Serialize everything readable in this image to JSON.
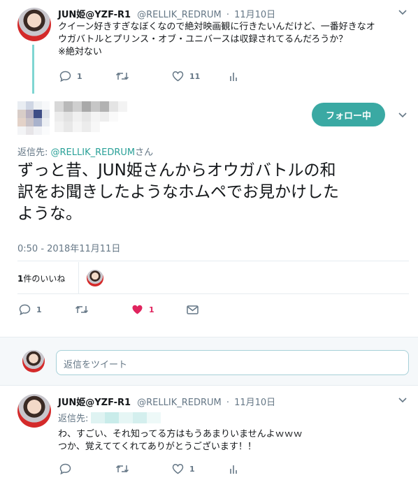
{
  "tweet1": {
    "name": "JUN姫@YZF-R1",
    "handle": "@RELLIK_REDRUM",
    "dot": "·",
    "date": "11月10日",
    "text_line1": "クイーン好きすぎなぼくなので絶対映画観に行きたいんだけど、一番好きなオ",
    "text_line2": "ウガバトルとプリンス・オブ・ユニバースは収録されてるんだろうか？",
    "text_line3": "※絶対ない",
    "reply_count": "1",
    "retweet_count": "",
    "like_count": "11"
  },
  "main": {
    "follow_label": "フォロー中",
    "reply_to_prefix": "返信先: ",
    "reply_to_handle": "@RELLIK_REDRUM",
    "reply_to_suffix": "さん",
    "text_line1": "ずっと昔、JUN姫さんからオウガバトルの和",
    "text_line2": "訳をお聞きしたようなホムペでお見かけした",
    "text_line3": "ような。",
    "timestamp": "0:50 - 2018年11月11日",
    "likes_number": "1",
    "likes_label": "件のいいね",
    "reply_count": "1",
    "like_count": "1"
  },
  "reply_box": {
    "placeholder": "返信をツイート"
  },
  "tweet3": {
    "name": "JUN姫@YZF-R1",
    "handle": "@RELLIK_REDRUM",
    "dot": "·",
    "date": "11月10日",
    "reply_to_prefix": "返信先:",
    "text_line1": "わ、すごい、それ知ってる方はもうあまりいませんよｗｗｗ",
    "text_line2": "つか、覚えててくれてありがとうございます！！",
    "like_count": "1"
  },
  "colors": {
    "accent": "#1da1f2",
    "teal": "#2aa198",
    "follow_button": "#3aa9a3",
    "like_red": "#e0245e",
    "thread_line": "#7fd6d2"
  }
}
